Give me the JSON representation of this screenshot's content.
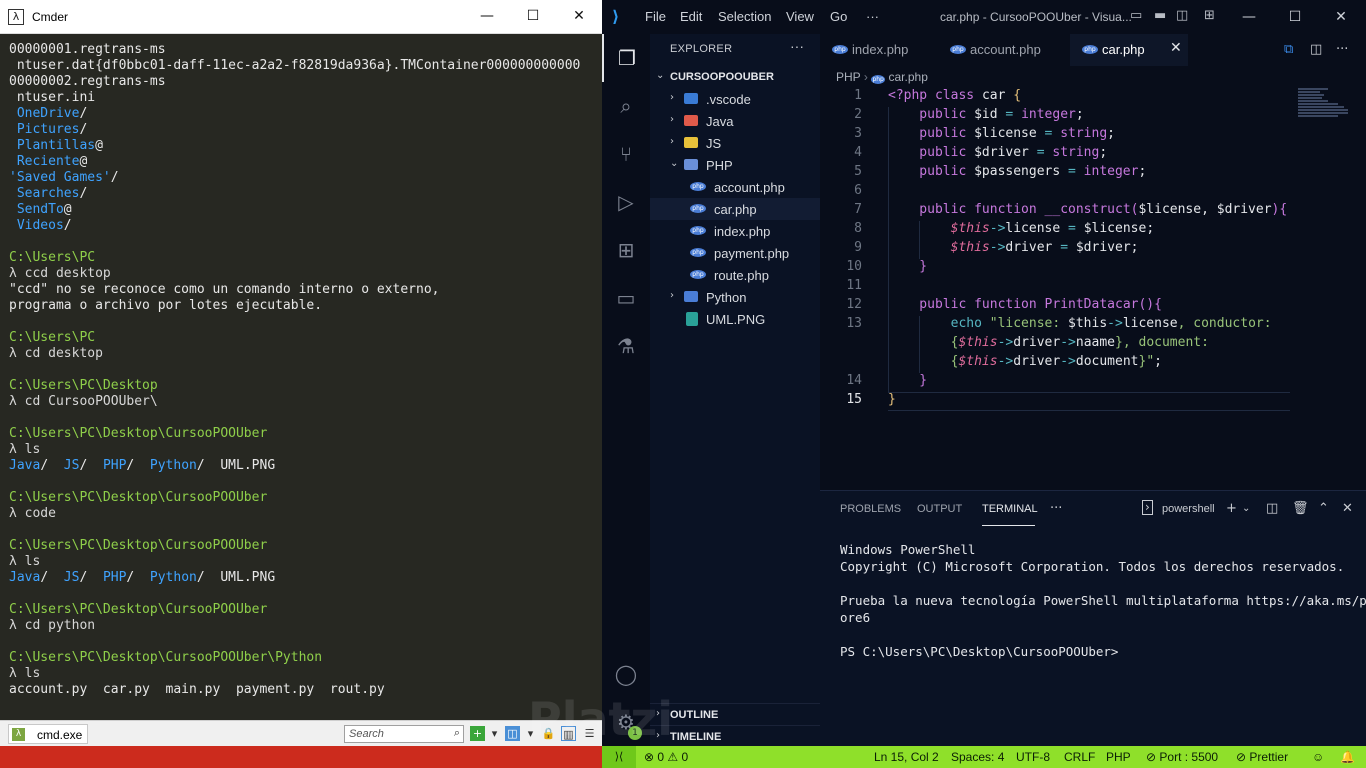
{
  "cmder": {
    "title": "Cmder",
    "lines": [
      [
        {
          "t": "00000001.regtrans-ms",
          "c": ""
        }
      ],
      [
        {
          "t": " ntuser.dat{df0bbc01-daff-11ec-a2a2-f82819da936a}.TMContainer000000000000",
          "c": ""
        }
      ],
      [
        {
          "t": "00000002.regtrans-ms",
          "c": ""
        }
      ],
      [
        {
          "t": " ntuser.ini",
          "c": ""
        }
      ],
      [
        {
          "t": " OneDrive",
          "c": "dir"
        },
        {
          "t": "/",
          "c": ""
        }
      ],
      [
        {
          "t": " Pictures",
          "c": "dir"
        },
        {
          "t": "/",
          "c": ""
        }
      ],
      [
        {
          "t": " Plantillas",
          "c": "dir"
        },
        {
          "t": "@",
          "c": ""
        }
      ],
      [
        {
          "t": " Reciente",
          "c": "dir"
        },
        {
          "t": "@",
          "c": ""
        }
      ],
      [
        {
          "t": "'Saved Games'",
          "c": "dir"
        },
        {
          "t": "/",
          "c": ""
        }
      ],
      [
        {
          "t": " Searches",
          "c": "dir"
        },
        {
          "t": "/",
          "c": ""
        }
      ],
      [
        {
          "t": " SendTo",
          "c": "dir"
        },
        {
          "t": "@",
          "c": ""
        }
      ],
      [
        {
          "t": " Videos",
          "c": "dir"
        },
        {
          "t": "/",
          "c": ""
        }
      ],
      [
        {
          "t": "",
          "c": ""
        }
      ],
      [
        {
          "t": "C:\\Users\\PC",
          "c": "path"
        }
      ],
      [
        {
          "t": "λ ccd desktop",
          "c": "prompt"
        }
      ],
      [
        {
          "t": "\"ccd\" no se reconoce como un comando interno o externo,",
          "c": ""
        }
      ],
      [
        {
          "t": "programa o archivo por lotes ejecutable.",
          "c": ""
        }
      ],
      [
        {
          "t": "",
          "c": ""
        }
      ],
      [
        {
          "t": "C:\\Users\\PC",
          "c": "path"
        }
      ],
      [
        {
          "t": "λ cd desktop",
          "c": "prompt"
        }
      ],
      [
        {
          "t": "",
          "c": ""
        }
      ],
      [
        {
          "t": "C:\\Users\\PC\\Desktop",
          "c": "path"
        }
      ],
      [
        {
          "t": "λ cd CursooPOOUber\\",
          "c": "prompt"
        }
      ],
      [
        {
          "t": "",
          "c": ""
        }
      ],
      [
        {
          "t": "C:\\Users\\PC\\Desktop\\CursooPOOUber",
          "c": "path"
        }
      ],
      [
        {
          "t": "λ ls",
          "c": "prompt"
        }
      ],
      [
        {
          "t": "Java",
          "c": "dir"
        },
        {
          "t": "/  ",
          "c": ""
        },
        {
          "t": "JS",
          "c": "dir"
        },
        {
          "t": "/  ",
          "c": ""
        },
        {
          "t": "PHP",
          "c": "dir"
        },
        {
          "t": "/  ",
          "c": ""
        },
        {
          "t": "Python",
          "c": "dir"
        },
        {
          "t": "/  UML.PNG",
          "c": ""
        }
      ],
      [
        {
          "t": "",
          "c": ""
        }
      ],
      [
        {
          "t": "C:\\Users\\PC\\Desktop\\CursooPOOUber",
          "c": "path"
        }
      ],
      [
        {
          "t": "λ code",
          "c": "prompt"
        }
      ],
      [
        {
          "t": "",
          "c": ""
        }
      ],
      [
        {
          "t": "C:\\Users\\PC\\Desktop\\CursooPOOUber",
          "c": "path"
        }
      ],
      [
        {
          "t": "λ ls",
          "c": "prompt"
        }
      ],
      [
        {
          "t": "Java",
          "c": "dir"
        },
        {
          "t": "/  ",
          "c": ""
        },
        {
          "t": "JS",
          "c": "dir"
        },
        {
          "t": "/  ",
          "c": ""
        },
        {
          "t": "PHP",
          "c": "dir"
        },
        {
          "t": "/  ",
          "c": ""
        },
        {
          "t": "Python",
          "c": "dir"
        },
        {
          "t": "/  UML.PNG",
          "c": ""
        }
      ],
      [
        {
          "t": "",
          "c": ""
        }
      ],
      [
        {
          "t": "C:\\Users\\PC\\Desktop\\CursooPOOUber",
          "c": "path"
        }
      ],
      [
        {
          "t": "λ cd python",
          "c": "prompt"
        }
      ],
      [
        {
          "t": "",
          "c": ""
        }
      ],
      [
        {
          "t": "C:\\Users\\PC\\Desktop\\CursooPOOUber\\Python",
          "c": "path"
        }
      ],
      [
        {
          "t": "λ ls",
          "c": "prompt"
        }
      ],
      [
        {
          "t": "account.py  car.py  main.py  payment.py  rout.py",
          "c": ""
        }
      ]
    ],
    "status": {
      "tab_label": "cmd.exe",
      "search_placeholder": "Search"
    }
  },
  "vscode": {
    "menu": [
      "File",
      "Edit",
      "Selection",
      "View",
      "Go",
      "···"
    ],
    "window_title": "car.php - CursooPOOUber - Visua...",
    "explorer": {
      "header": "EXPLORER",
      "root": "CURSOOPOOUBER",
      "items": [
        {
          "label": ".vscode",
          "kind": "folder",
          "depth": 0,
          "color": "#3a7bd5"
        },
        {
          "label": "Java",
          "kind": "folder",
          "depth": 0,
          "color": "#e05a4a"
        },
        {
          "label": "JS",
          "kind": "folder",
          "depth": 0,
          "color": "#e8c13a"
        },
        {
          "label": "PHP",
          "kind": "folder-open",
          "depth": 0,
          "color": "#6a8fd8"
        },
        {
          "label": "account.php",
          "kind": "php",
          "depth": 1
        },
        {
          "label": "car.php",
          "kind": "php",
          "depth": 1,
          "selected": true
        },
        {
          "label": "index.php",
          "kind": "php",
          "depth": 1
        },
        {
          "label": "payment.php",
          "kind": "php",
          "depth": 1
        },
        {
          "label": "route.php",
          "kind": "php",
          "depth": 1
        },
        {
          "label": "Python",
          "kind": "folder",
          "depth": 0,
          "color": "#4a7dd6"
        },
        {
          "label": "UML.PNG",
          "kind": "png",
          "depth": 0
        }
      ],
      "outline": "OUTLINE",
      "timeline": "TIMELINE"
    },
    "tabs": [
      {
        "label": "index.php",
        "active": false
      },
      {
        "label": "account.php",
        "active": false
      },
      {
        "label": "car.php",
        "active": true
      }
    ],
    "breadcrumb": {
      "folder": "PHP",
      "file": "car.php"
    },
    "code": [
      {
        "n": "1",
        "s": [
          [
            "<?php ",
            "tag"
          ],
          [
            "class ",
            "kw"
          ],
          [
            "car ",
            "vr"
          ],
          [
            "{",
            "br1"
          ]
        ]
      },
      {
        "n": "2",
        "s": [
          [
            "    public ",
            "kw"
          ],
          [
            "$id ",
            "vr"
          ],
          [
            "= ",
            "op"
          ],
          [
            "integer",
            "ty"
          ],
          [
            ";",
            "vr"
          ]
        ]
      },
      {
        "n": "3",
        "s": [
          [
            "    public ",
            "kw"
          ],
          [
            "$license ",
            "vr"
          ],
          [
            "= ",
            "op"
          ],
          [
            "string",
            "ty"
          ],
          [
            ";",
            "vr"
          ]
        ]
      },
      {
        "n": "4",
        "s": [
          [
            "    public ",
            "kw"
          ],
          [
            "$driver ",
            "vr"
          ],
          [
            "= ",
            "op"
          ],
          [
            "string",
            "ty"
          ],
          [
            ";",
            "vr"
          ]
        ]
      },
      {
        "n": "5",
        "s": [
          [
            "    public ",
            "kw"
          ],
          [
            "$passengers ",
            "vr"
          ],
          [
            "= ",
            "op"
          ],
          [
            "integer",
            "ty"
          ],
          [
            ";",
            "vr"
          ]
        ]
      },
      {
        "n": "6",
        "s": []
      },
      {
        "n": "7",
        "s": [
          [
            "    public ",
            "kw"
          ],
          [
            "function ",
            "kw"
          ],
          [
            "__construct",
            "fn"
          ],
          [
            "(",
            "br2"
          ],
          [
            "$license",
            "vr"
          ],
          [
            ", ",
            "vr"
          ],
          [
            "$driver",
            "vr"
          ],
          [
            ")",
            "br2"
          ],
          [
            "{",
            "br2"
          ]
        ]
      },
      {
        "n": "8",
        "s": [
          [
            "        $this",
            "th"
          ],
          [
            "->",
            "op"
          ],
          [
            "license ",
            "vr"
          ],
          [
            "= ",
            "op"
          ],
          [
            "$license",
            "vr"
          ],
          [
            ";",
            "vr"
          ]
        ]
      },
      {
        "n": "9",
        "s": [
          [
            "        $this",
            "th"
          ],
          [
            "->",
            "op"
          ],
          [
            "driver ",
            "vr"
          ],
          [
            "= ",
            "op"
          ],
          [
            "$driver",
            "vr"
          ],
          [
            ";",
            "vr"
          ]
        ]
      },
      {
        "n": "10",
        "s": [
          [
            "    }",
            "br2"
          ]
        ]
      },
      {
        "n": "11",
        "s": []
      },
      {
        "n": "12",
        "s": [
          [
            "    public ",
            "kw"
          ],
          [
            "function ",
            "kw"
          ],
          [
            "PrintDatacar",
            "fn"
          ],
          [
            "()",
            "br2"
          ],
          [
            "{",
            "br2"
          ]
        ]
      },
      {
        "n": "13",
        "s": [
          [
            "        echo ",
            "op"
          ],
          [
            "\"license: ",
            "st"
          ],
          [
            "$this",
            "vr"
          ],
          [
            "->",
            "op"
          ],
          [
            "license",
            "vr"
          ],
          [
            ", conductor:",
            "st"
          ]
        ]
      },
      {
        "n": "",
        "s": [
          [
            "        {",
            "st"
          ],
          [
            "$this",
            "th"
          ],
          [
            "->",
            "op"
          ],
          [
            "driver",
            "vr"
          ],
          [
            "->",
            "op"
          ],
          [
            "naame",
            "vr"
          ],
          [
            "}",
            "st"
          ],
          [
            ", document:",
            "st"
          ]
        ]
      },
      {
        "n": "",
        "s": [
          [
            "        {",
            "st"
          ],
          [
            "$this",
            "th"
          ],
          [
            "->",
            "op"
          ],
          [
            "driver",
            "vr"
          ],
          [
            "->",
            "op"
          ],
          [
            "document",
            "vr"
          ],
          [
            "}\"",
            "st"
          ],
          [
            ";",
            "vr"
          ]
        ]
      },
      {
        "n": "14",
        "s": [
          [
            "    }",
            "br2"
          ]
        ]
      },
      {
        "n": "15",
        "s": [
          [
            "}",
            "br1"
          ]
        ]
      }
    ],
    "panel": {
      "tabs": [
        "PROBLEMS",
        "OUTPUT",
        "TERMINAL"
      ],
      "active_tab": "TERMINAL",
      "shell": "powershell",
      "terminal_lines": [
        "Windows PowerShell",
        "Copyright (C) Microsoft Corporation. Todos los derechos reservados.",
        "",
        "Prueba la nueva tecnología PowerShell multiplataforma https://aka.ms/psc",
        "ore6",
        "",
        "PS C:\\Users\\PC\\Desktop\\CursooPOOUber>"
      ]
    },
    "status": {
      "problems": "⊗ 0 ⚠ 0",
      "position": "Ln 15, Col 2",
      "spaces": "Spaces: 4",
      "encoding": "UTF-8",
      "eol": "CRLF",
      "language": "PHP",
      "port": "⊘ Port : 5500",
      "prettier": "⊘ Prettier",
      "badge": "1"
    }
  },
  "watermark": "Platzi"
}
